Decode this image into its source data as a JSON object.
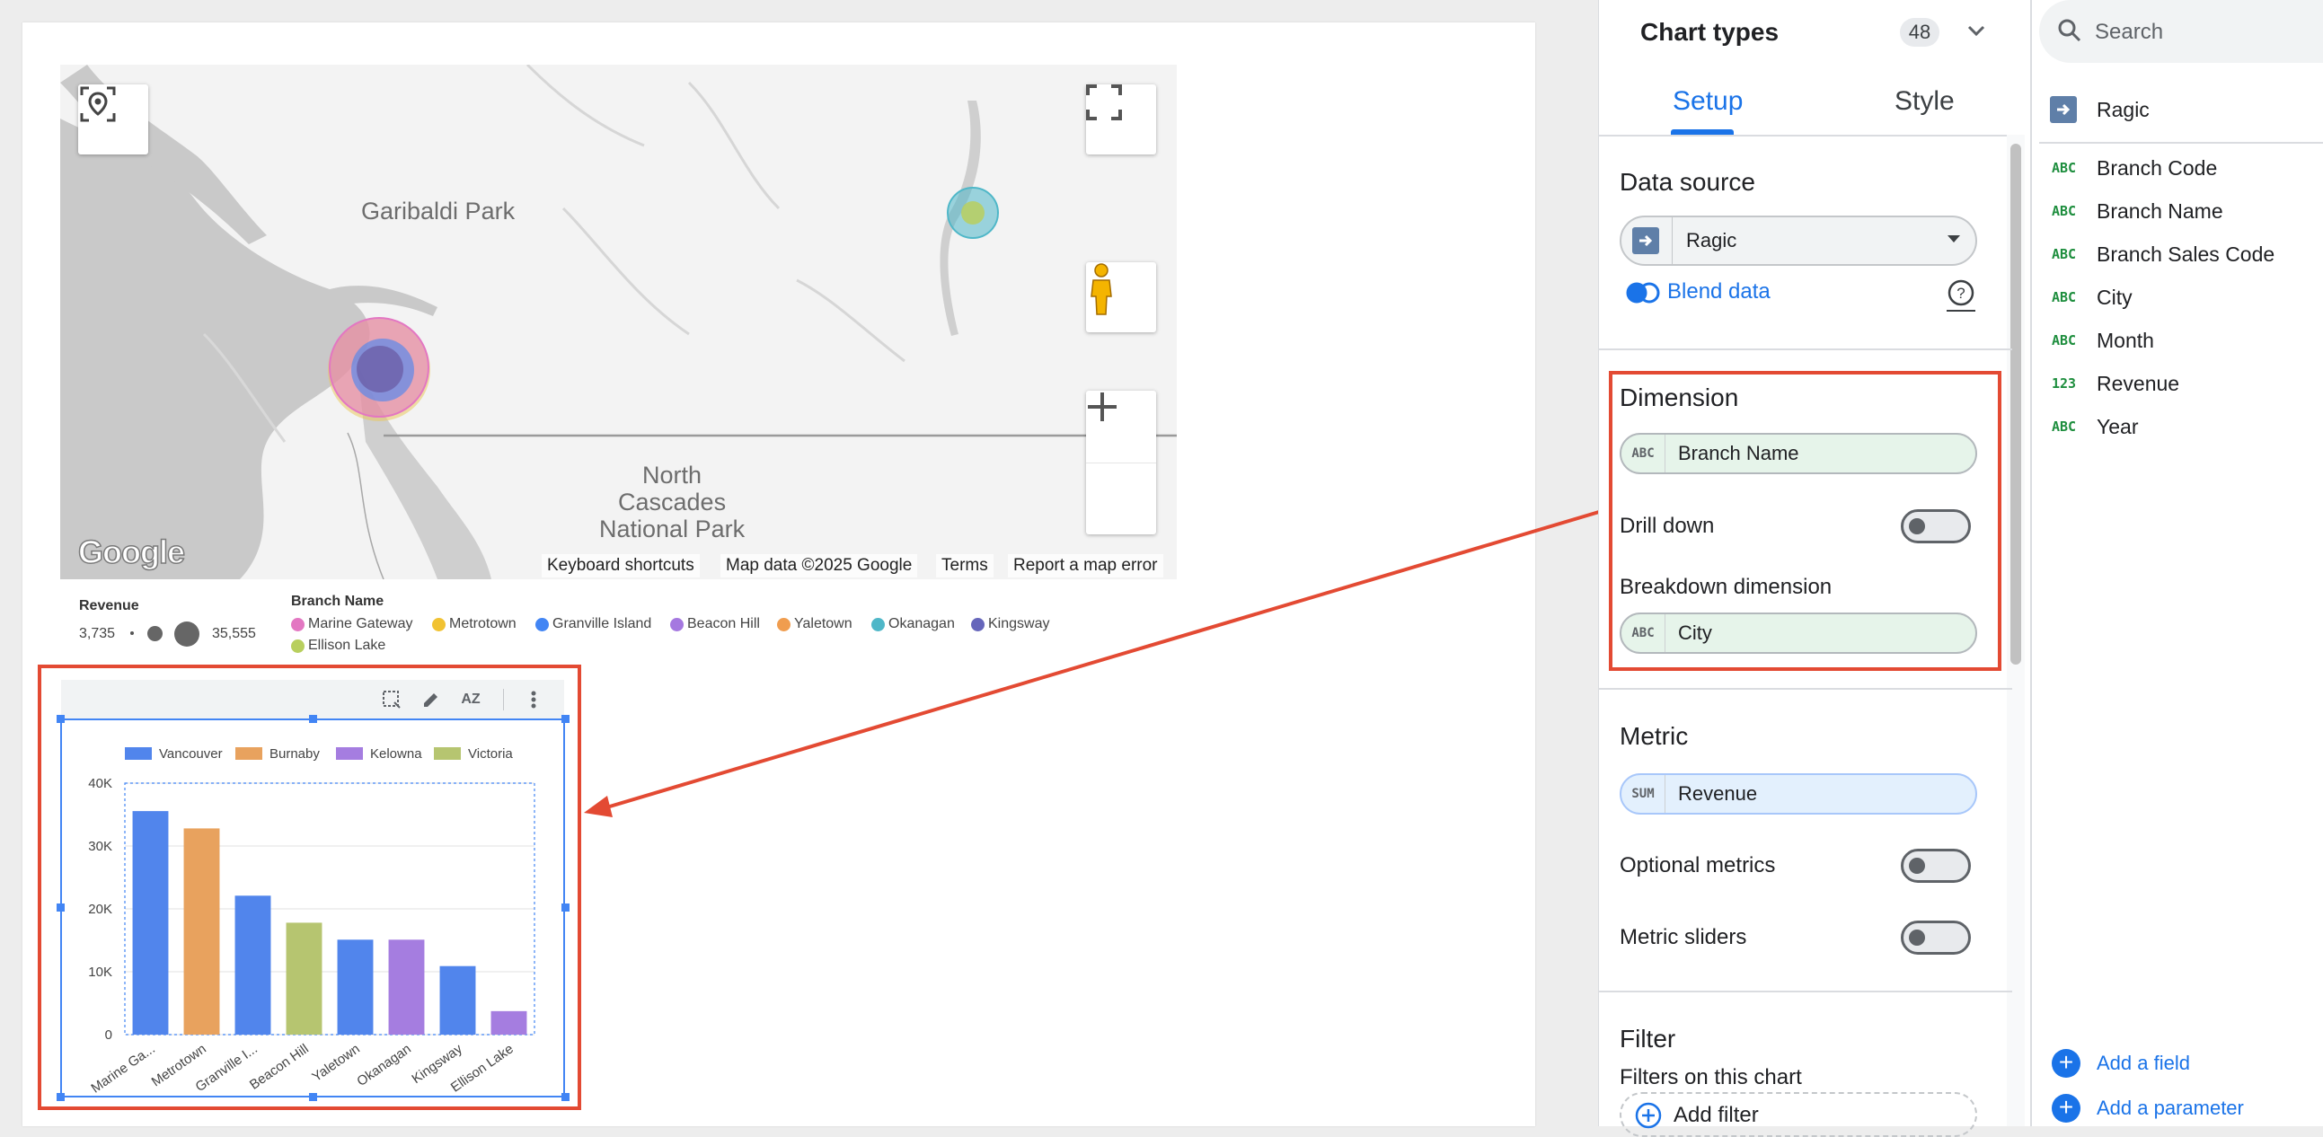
{
  "map": {
    "labels": {
      "garibaldi": "Garibaldi Park",
      "north_cascades": "North\nCascades\nNational Park"
    },
    "logo": "Google",
    "footer": {
      "shortcuts": "Keyboard shortcuts",
      "mapdata": "Map data ©2025 Google",
      "terms": "Terms",
      "report": "Report a map error"
    },
    "icons": {
      "locate": "location-search-icon",
      "fullscreen": "fullscreen-icon",
      "pegman": "pegman-icon",
      "zoom_in": "plus-icon",
      "zoom_out": "minus-icon"
    }
  },
  "legend": {
    "revenue_title": "Revenue",
    "revenue_min": "3,735",
    "revenue_max": "35,555",
    "branch_title": "Branch Name",
    "branches": [
      {
        "name": "Marine Gateway",
        "color": "#e377c2"
      },
      {
        "name": "Metrotown",
        "color": "#f1c232"
      },
      {
        "name": "Granville Island",
        "color": "#4285f4"
      },
      {
        "name": "Beacon Hill",
        "color": "#a578e0"
      },
      {
        "name": "Yaletown",
        "color": "#f09d4f"
      },
      {
        "name": "Okanagan",
        "color": "#4fb7c8"
      },
      {
        "name": "Kingsway",
        "color": "#6666bb"
      },
      {
        "name": "Ellison Lake",
        "color": "#b8cf5e"
      }
    ]
  },
  "chart_toolbar": {
    "icons": [
      "select-icon",
      "edit-icon",
      "sort-az-icon",
      "more-vert-icon"
    ],
    "sort_label": "AZ"
  },
  "chart_data": {
    "type": "bar",
    "categories": [
      "Marine Ga...",
      "Metrotown",
      "Granville I...",
      "Beacon Hill",
      "Yaletown",
      "Okanagan",
      "Kingsway",
      "Ellison Lake"
    ],
    "values": [
      35555,
      32800,
      22100,
      17800,
      15100,
      15100,
      10900,
      3735
    ],
    "bar_series": [
      "Vancouver",
      "Burnaby",
      "Vancouver",
      "Victoria",
      "Vancouver",
      "Kelowna",
      "Vancouver",
      "Kelowna"
    ],
    "series": [
      {
        "name": "Vancouver",
        "color": "#5185ec"
      },
      {
        "name": "Burnaby",
        "color": "#e8a25e"
      },
      {
        "name": "Kelowna",
        "color": "#a57de0"
      },
      {
        "name": "Victoria",
        "color": "#b6c570"
      }
    ],
    "yticks": [
      "0",
      "10K",
      "20K",
      "30K",
      "40K"
    ],
    "ylim": [
      0,
      40000
    ],
    "legend_position": "top",
    "grid": true
  },
  "panel": {
    "title": "Chart types",
    "count": "48",
    "tabs": {
      "setup": "Setup",
      "style": "Style"
    },
    "data_source": {
      "title": "Data source",
      "value": "Ragic",
      "blend": "Blend data"
    },
    "dimension": {
      "title": "Dimension",
      "chip_type": "ABC",
      "value": "Branch Name",
      "drill_down": "Drill down",
      "breakdown_label": "Breakdown dimension",
      "breakdown_type": "ABC",
      "breakdown_value": "City"
    },
    "metric": {
      "title": "Metric",
      "chip_type": "SUM",
      "value": "Revenue",
      "optional": "Optional metrics",
      "sliders": "Metric sliders"
    },
    "filter": {
      "title": "Filter",
      "subtitle": "Filters on this chart",
      "add": "Add filter"
    }
  },
  "fields": {
    "search_placeholder": "Search",
    "source": "Ragic",
    "items": [
      {
        "type": "ABC",
        "name": "Branch Code"
      },
      {
        "type": "ABC",
        "name": "Branch Name"
      },
      {
        "type": "ABC",
        "name": "Branch Sales Code"
      },
      {
        "type": "ABC",
        "name": "City"
      },
      {
        "type": "ABC",
        "name": "Month"
      },
      {
        "type": "123",
        "name": "Revenue"
      },
      {
        "type": "ABC",
        "name": "Year"
      }
    ],
    "add_field": "Add a field",
    "add_parameter": "Add a parameter"
  }
}
